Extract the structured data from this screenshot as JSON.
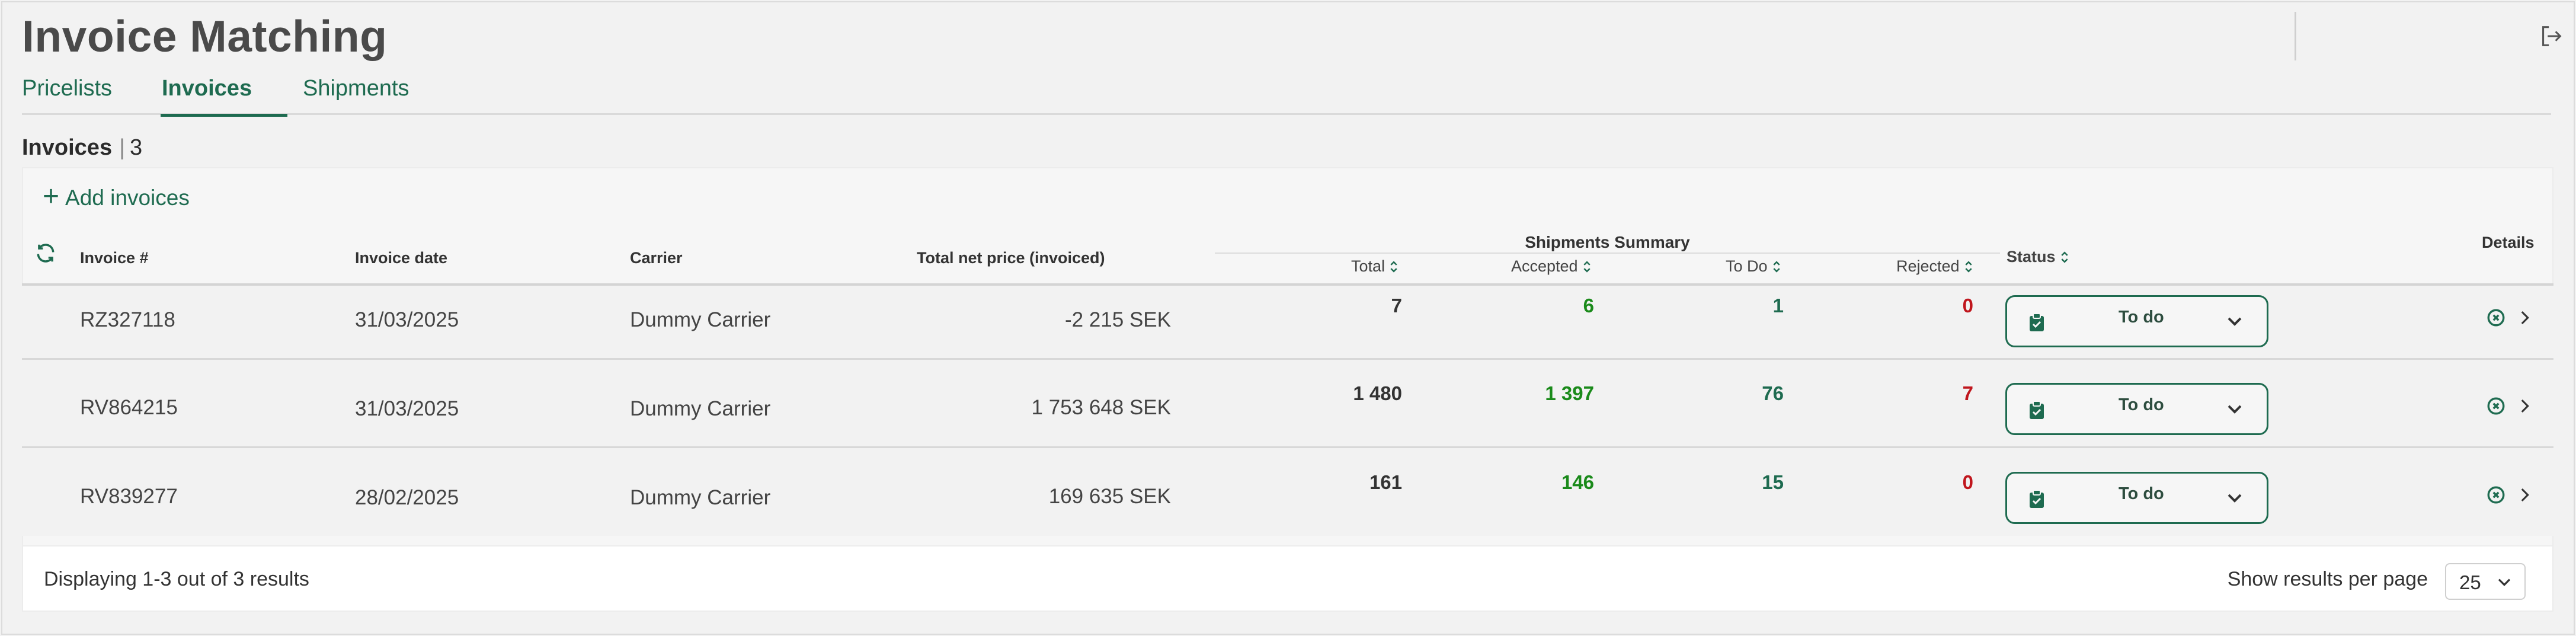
{
  "app": {
    "title": "Invoice Matching"
  },
  "tabs": [
    {
      "label": "Pricelists",
      "active": false
    },
    {
      "label": "Invoices",
      "active": true
    },
    {
      "label": "Shipments",
      "active": false
    }
  ],
  "section": {
    "title": "Invoices",
    "count": "3"
  },
  "toolbar": {
    "add_label": "Add invoices"
  },
  "table": {
    "columns": {
      "invoice": "Invoice #",
      "date": "Invoice date",
      "carrier": "Carrier",
      "net_price": "Total net price (invoiced)",
      "summary": "Shipments Summary",
      "total": "Total",
      "accepted": "Accepted",
      "todo": "To Do",
      "rejected": "Rejected",
      "status": "Status",
      "details": "Details"
    },
    "rows": [
      {
        "invoice": "RZ327118",
        "date": "31/03/2025",
        "carrier": "Dummy Carrier",
        "net_price": "-2 215 SEK",
        "total": "7",
        "accepted": "6",
        "todo": "1",
        "rejected": "0",
        "status": "To do"
      },
      {
        "invoice": "RV864215",
        "date": "31/03/2025",
        "carrier": "Dummy Carrier",
        "net_price": "1 753 648 SEK",
        "total": "1 480",
        "accepted": "1 397",
        "todo": "76",
        "rejected": "7",
        "status": "To do"
      },
      {
        "invoice": "RV839277",
        "date": "28/02/2025",
        "carrier": "Dummy Carrier",
        "net_price": "169 635 SEK",
        "total": "161",
        "accepted": "146",
        "todo": "15",
        "rejected": "0",
        "status": "To do"
      }
    ]
  },
  "footer": {
    "displaying": "Displaying 1-3 out of 3 results",
    "per_page_label": "Show results per page",
    "per_page_value": "25"
  },
  "colors": {
    "brand": "#1e6b50",
    "accepted": "#1a8a1a",
    "rejected": "#c0161d"
  },
  "icons": {
    "logout": "logout-icon",
    "refresh": "refresh-icon",
    "sort": "sort-icon",
    "clipboard": "clipboard-icon",
    "chevron_down": "chevron-down-icon",
    "close_circle": "close-circle-icon",
    "chevron_right": "chevron-right-icon"
  }
}
